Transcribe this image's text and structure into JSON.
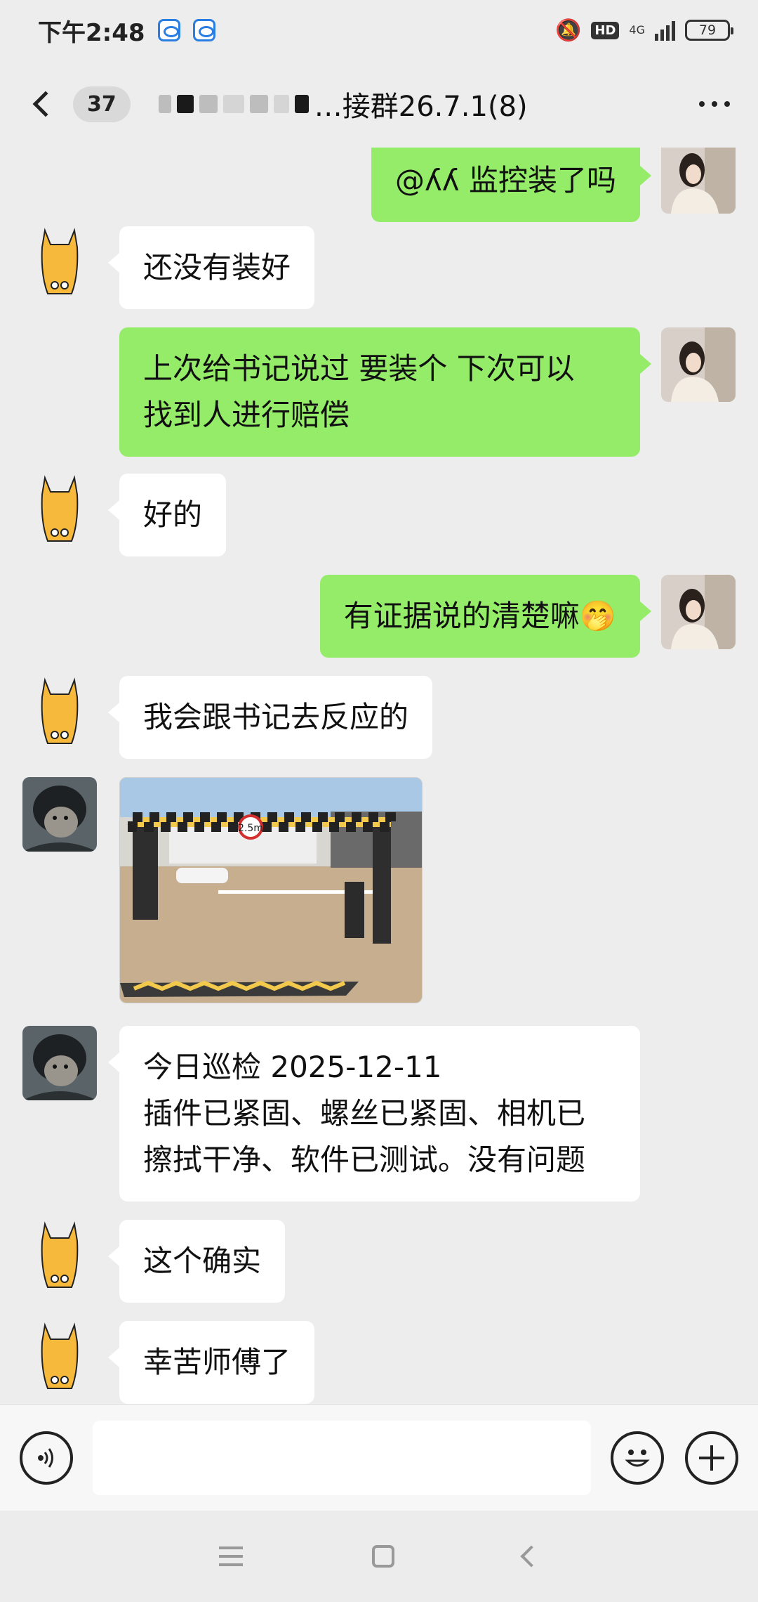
{
  "status_bar": {
    "time": "下午2:48",
    "hd": "HD",
    "network": "4G",
    "battery": "79"
  },
  "header": {
    "unread_count": "37",
    "title_visible": "…接群26.7.1(8)"
  },
  "messages": [
    {
      "side": "out",
      "text": "@ʎʎ 监控装了吗"
    },
    {
      "side": "in",
      "text": "还没有装好"
    },
    {
      "side": "out",
      "lines": [
        "上次给书记说过 要装个 下次可以",
        "找到人进行赔偿"
      ]
    },
    {
      "side": "in",
      "text": "好的"
    },
    {
      "side": "out",
      "text": "有证据说的清楚嘛",
      "emoji": "🤭"
    },
    {
      "side": "in",
      "text": "我会跟书记去反应的"
    },
    {
      "side": "in",
      "type": "image",
      "sign": "2.5m"
    },
    {
      "side": "in",
      "lines": [
        "今日巡检 2025-12-11",
        "插件已紧固、螺丝已紧固、相机已",
        "擦拭干净、软件已测试。没有问题"
      ]
    },
    {
      "side": "in",
      "text": "这个确实"
    },
    {
      "side": "in",
      "text": "幸苦师傅了"
    }
  ],
  "colors": {
    "background": "#ededed",
    "outgoing_bubble": "#95ec69",
    "incoming_bubble": "#ffffff"
  },
  "icons": {
    "voice": "voice-icon",
    "emoji": "emoji-icon",
    "plus": "plus-icon",
    "back": "back-chevron-icon",
    "more": "more-icon"
  }
}
